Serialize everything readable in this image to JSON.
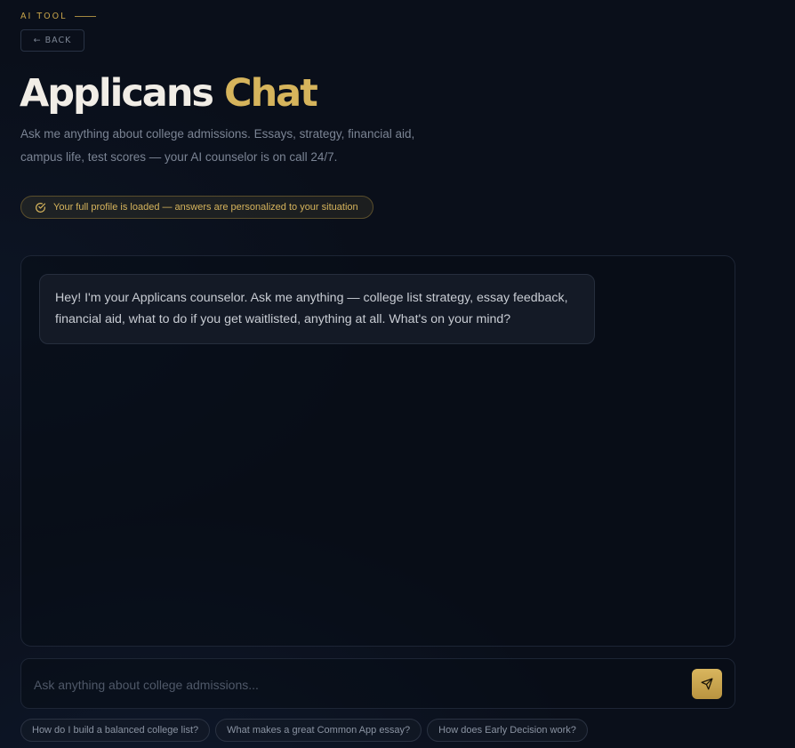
{
  "header": {
    "eyebrow": "AI TOOL",
    "back_label": "← BACK",
    "title_main": "Applicans",
    "title_accent": "Chat",
    "subtitle_line1": "Ask me anything about college admissions. Essays, strategy, financial aid,",
    "subtitle_line2": "campus life, test scores — your AI counselor is on call 24/7.",
    "profile_badge": "Your full profile is loaded — answers are personalized to your situation"
  },
  "chat": {
    "messages": [
      {
        "role": "assistant",
        "text": "Hey! I'm your Applicans counselor. Ask me anything — college list strategy, essay feedback, financial aid, what to do if you get waitlisted, anything at all. What's on your mind?"
      }
    ]
  },
  "input": {
    "placeholder": "Ask anything about college admissions...",
    "value": "",
    "send_icon": "send-icon"
  },
  "suggestions": [
    "How do I build a balanced college list?",
    "What makes a great Common App essay?",
    "How does Early Decision work?"
  ],
  "colors": {
    "background": "#0a0f1a",
    "accent_gold": "#d6b45c",
    "text_primary": "#f1ede6",
    "text_muted": "#7b8494"
  }
}
